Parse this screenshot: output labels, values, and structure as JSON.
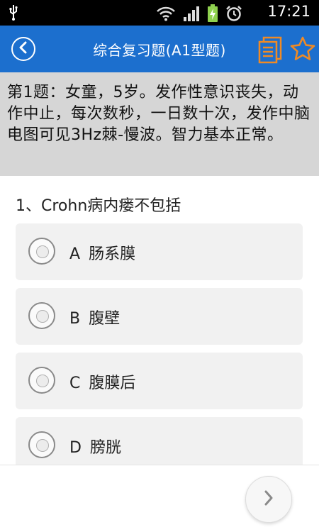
{
  "status_bar": {
    "time": "17:21",
    "icons": [
      "usb-icon",
      "wifi-icon",
      "signal-icon",
      "battery-charging-icon",
      "alarm-icon"
    ]
  },
  "header": {
    "title": "综合复习题(A1型题)",
    "back_icon": "back-circle-icon",
    "actions": [
      "document-list-icon",
      "star-icon"
    ],
    "accent_color": "#1c6fce",
    "icon_orange": "#f08a24"
  },
  "question": {
    "stem": "第1题：女童，5岁。发作性意识丧失，动作中止，每次数秒，一日数十次，发作中脑电图可见3Hz棘-慢波。智力基本正常。",
    "title": "1、Crohn病内瘘不包括",
    "options": [
      {
        "letter": "A",
        "text": "肠系膜"
      },
      {
        "letter": "B",
        "text": "腹壁"
      },
      {
        "letter": "C",
        "text": "腹膜后"
      },
      {
        "letter": "D",
        "text": "膀胱"
      }
    ]
  },
  "footer": {
    "next_icon": "chevron-right-icon"
  }
}
